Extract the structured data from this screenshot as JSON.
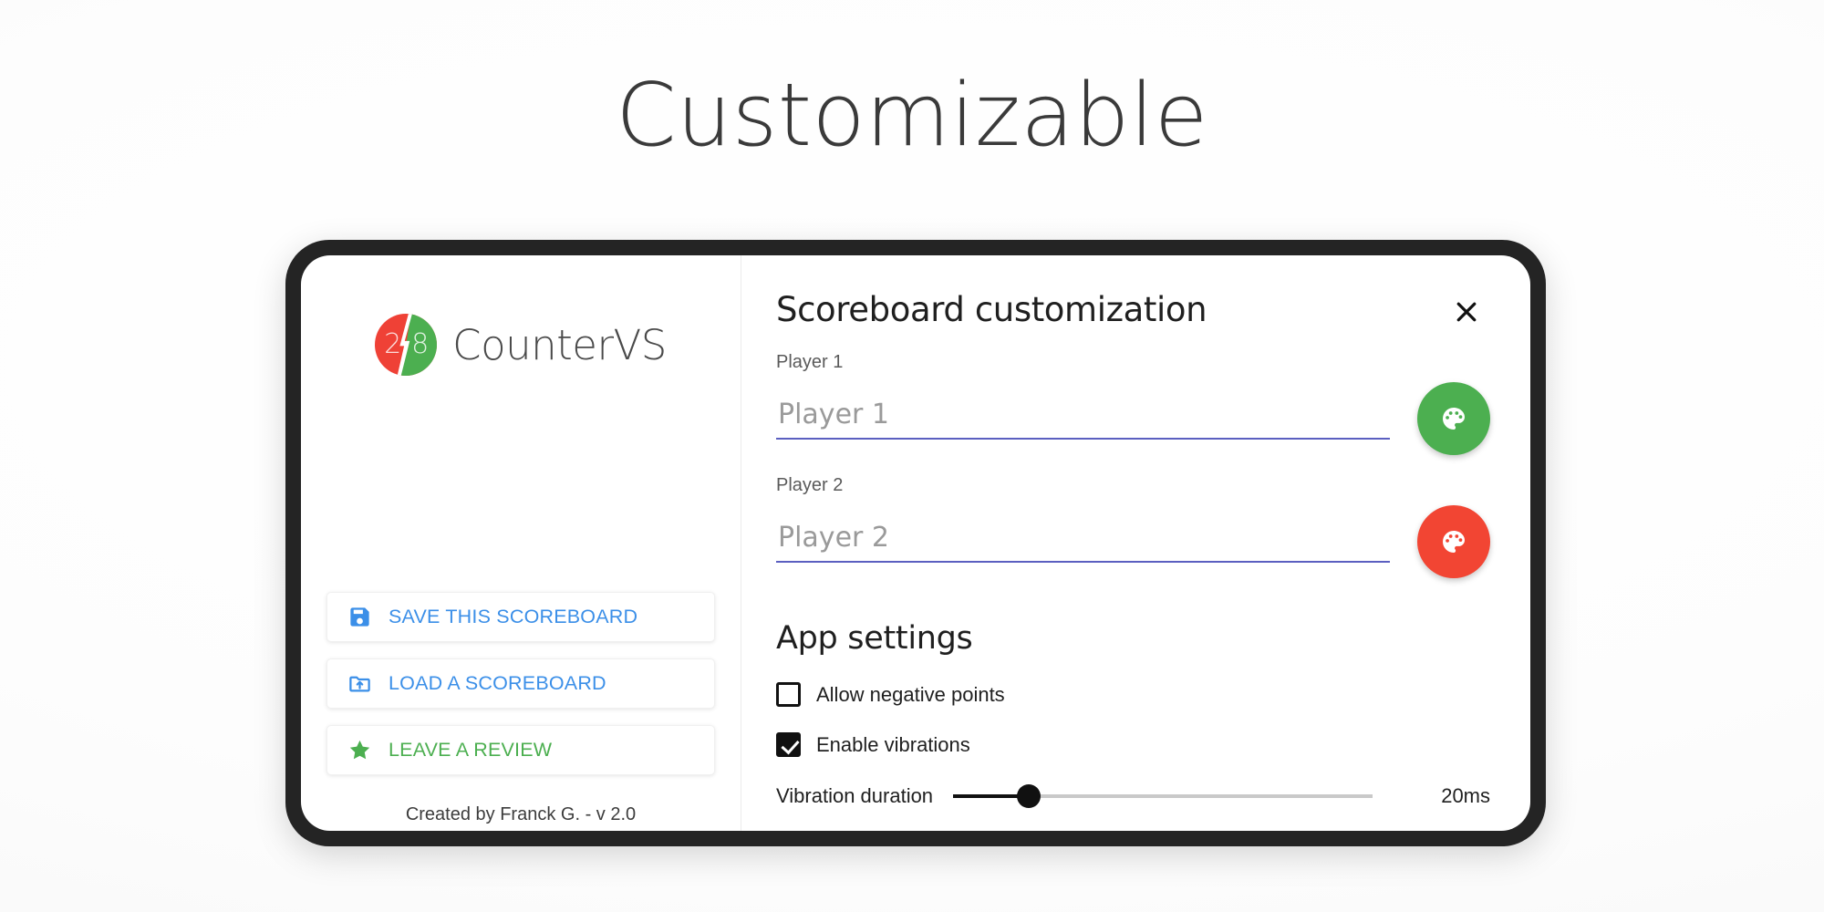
{
  "page": {
    "headline": "Customizable"
  },
  "sidebar": {
    "logo": {
      "left_number": "2",
      "right_number": "8",
      "left_color": "#ef4136",
      "right_color": "#4caf50"
    },
    "brand_name": "CounterVS",
    "actions": [
      {
        "label": "SAVE THIS SCOREBOARD",
        "icon": "save-icon",
        "color": "#3b8fe8"
      },
      {
        "label": "LOAD A SCOREBOARD",
        "icon": "folder-upload-icon",
        "color": "#3b8fe8"
      },
      {
        "label": "LEAVE A REVIEW",
        "icon": "star-icon",
        "color": "#4caf50"
      }
    ],
    "footer": "Created by Franck G. - v 2.0"
  },
  "panel": {
    "title": "Scoreboard customization",
    "close_icon": "close-icon",
    "fields": [
      {
        "label": "Player 1",
        "value": "",
        "placeholder": "Player 1",
        "color_button": {
          "icon": "palette-icon",
          "color": "#4caf50"
        }
      },
      {
        "label": "Player 2",
        "value": "",
        "placeholder": "Player 2",
        "color_button": {
          "icon": "palette-icon",
          "color": "#f24533"
        }
      }
    ],
    "settings": {
      "title": "App settings",
      "checkboxes": [
        {
          "label": "Allow negative points",
          "checked": false
        },
        {
          "label": "Enable vibrations",
          "checked": true
        }
      ],
      "slider": {
        "label": "Vibration duration",
        "value": "20ms",
        "percent": 18
      }
    }
  },
  "colors": {
    "accent_blue": "#3b8fe8",
    "accent_green": "#4caf50",
    "accent_red": "#f24533",
    "input_underline": "#5b5fc0",
    "frame": "#242424"
  }
}
